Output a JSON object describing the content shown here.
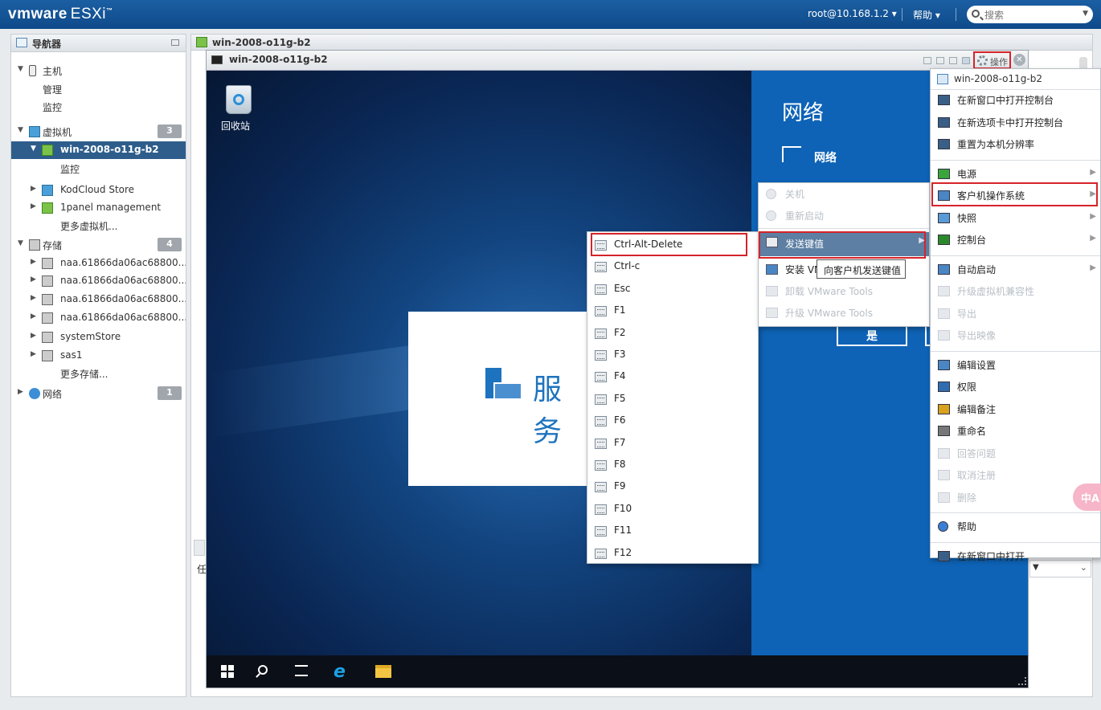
{
  "header": {
    "brand": "vmware",
    "product": "ESXi",
    "trademark": "™",
    "user": "root@10.168.1.2 ▾",
    "help": "帮助 ▾",
    "search_placeholder": "搜索"
  },
  "navigator": {
    "title": "导航器",
    "items": [
      {
        "label": "主机",
        "level": 0,
        "expand": "▼",
        "icon": "host-icon"
      },
      {
        "label": "管理",
        "level": 1
      },
      {
        "label": "监控",
        "level": 1
      },
      {
        "label": "虚拟机",
        "level": 0,
        "expand": "▼",
        "icon": "vm-icon",
        "badge": "3"
      },
      {
        "label": "win-2008-o11g-b2",
        "level": 1,
        "expand": "▼",
        "icon": "vm-powered-on-icon",
        "selected": true
      },
      {
        "label": "监控",
        "level": 2
      },
      {
        "label": "KodCloud Store",
        "level": 1,
        "expand": "▶",
        "icon": "vm-icon"
      },
      {
        "label": "1panel management",
        "level": 1,
        "expand": "▶",
        "icon": "vm-powered-on-icon"
      },
      {
        "label": "更多虚拟机...",
        "level": 2
      },
      {
        "label": "存储",
        "level": 0,
        "expand": "▼",
        "icon": "storage-icon",
        "badge": "4"
      },
      {
        "label": "naa.61866da06ac68800...",
        "level": 1,
        "expand": "▶",
        "icon": "disk-icon"
      },
      {
        "label": "naa.61866da06ac68800...",
        "level": 1,
        "expand": "▶",
        "icon": "disk-icon"
      },
      {
        "label": "naa.61866da06ac68800...",
        "level": 1,
        "expand": "▶",
        "icon": "disk-icon"
      },
      {
        "label": "naa.61866da06ac68800...",
        "level": 1,
        "expand": "▶",
        "icon": "disk-icon"
      },
      {
        "label": "systemStore",
        "level": 1,
        "expand": "▶",
        "icon": "datastore-icon"
      },
      {
        "label": "sas1",
        "level": 1,
        "expand": "▶",
        "icon": "datastore-icon"
      },
      {
        "label": "更多存储...",
        "level": 2
      },
      {
        "label": "网络",
        "level": 0,
        "expand": "▶",
        "icon": "network-icon",
        "badge": "1"
      }
    ]
  },
  "main": {
    "title": "win-2008-o11g-b2",
    "lower_tab_label": "任"
  },
  "console": {
    "title": "win-2008-o11g-b2",
    "ops_label": "操作",
    "close_label": "✕",
    "desktop": {
      "recycle_bin_label": "回收站",
      "server_manager_text": "服务"
    },
    "network_pane": {
      "title": "网络",
      "subtitle": "网络",
      "yes_label": "是"
    }
  },
  "keys_menu": {
    "items": [
      "Ctrl-Alt-Delete",
      "Ctrl-c",
      "Esc",
      "F1",
      "F2",
      "F3",
      "F4",
      "F5",
      "F6",
      "F7",
      "F8",
      "F9",
      "F10",
      "F11",
      "F12"
    ]
  },
  "guest_menu": {
    "items": [
      {
        "label": "关机",
        "disabled": true,
        "icon": "power-off-icon"
      },
      {
        "label": "重新启动",
        "disabled": true,
        "icon": "restart-icon"
      },
      {
        "label": "发送键值",
        "disabled": false,
        "icon": "keyboard-icon",
        "submenu": true,
        "highlighted": true
      },
      {
        "label": "安装 VMware Tools",
        "disabled": false,
        "icon": "install-icon",
        "visible_text": "安装 VM"
      },
      {
        "label": "卸载 VMware Tools",
        "disabled": true,
        "icon": "uninstall-icon"
      },
      {
        "label": "升级 VMware Tools",
        "disabled": true,
        "icon": "upgrade-icon"
      }
    ],
    "tooltip": "向客户机发送键值"
  },
  "actions_menu": {
    "header": "win-2008-o11g-b2",
    "items": [
      {
        "label": "在新窗口中打开控制台",
        "icon": "console-window-icon"
      },
      {
        "label": "在新选项卡中打开控制台",
        "icon": "console-tab-icon"
      },
      {
        "label": "重置为本机分辨率",
        "icon": "resolution-icon"
      },
      {
        "sep": true
      },
      {
        "label": "电源",
        "icon": "power-icon",
        "submenu": true
      },
      {
        "label": "客户机操作系统",
        "icon": "guest-os-icon",
        "submenu": true,
        "highlighted": true
      },
      {
        "label": "快照",
        "icon": "snapshot-icon",
        "submenu": true
      },
      {
        "label": "控制台",
        "icon": "console-icon",
        "submenu": true
      },
      {
        "sep": true
      },
      {
        "label": "自动启动",
        "icon": "autostart-icon",
        "submenu": true
      },
      {
        "label": "升级虚拟机兼容性",
        "icon": "upgrade-compat-icon",
        "disabled": true
      },
      {
        "label": "导出",
        "icon": "export-icon",
        "disabled": true
      },
      {
        "label": "导出映像",
        "icon": "export-image-icon",
        "disabled": true
      },
      {
        "sep": true
      },
      {
        "label": "编辑设置",
        "icon": "edit-settings-icon"
      },
      {
        "label": "权限",
        "icon": "permissions-icon"
      },
      {
        "label": "编辑备注",
        "icon": "edit-notes-icon"
      },
      {
        "label": "重命名",
        "icon": "rename-icon"
      },
      {
        "label": "回答问题",
        "icon": "answer-icon",
        "disabled": true
      },
      {
        "label": "取消注册",
        "icon": "unregister-icon",
        "disabled": true
      },
      {
        "label": "删除",
        "icon": "delete-icon",
        "disabled": true
      },
      {
        "sep": true
      },
      {
        "label": "帮助",
        "icon": "help-icon"
      },
      {
        "sep": true
      },
      {
        "label": "在新窗口中打开",
        "icon": "open-new-window-icon"
      }
    ]
  },
  "translate_widget": "中A",
  "colors": {
    "topbar": "#1b5fa2",
    "selected": "#2e5d8b",
    "highlight": "#d6232a",
    "network_pane": "#0e63b6"
  }
}
